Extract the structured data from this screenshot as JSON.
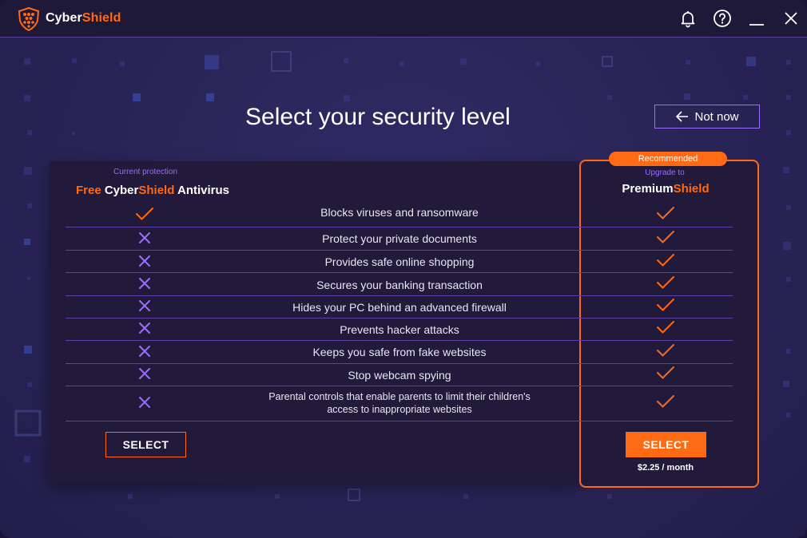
{
  "app": {
    "title_part1": "Cyber",
    "title_part2": "Shield",
    "logo_icon": "shield-icon"
  },
  "titlebar_icons": [
    "bell-icon",
    "help-icon",
    "minimize-icon",
    "close-icon"
  ],
  "headline": "Select your security level",
  "not_now": {
    "label": "Not now",
    "icon": "arrow-left-icon"
  },
  "free_plan": {
    "subtitle": "Current protection",
    "title_part1": "Free ",
    "title_part2": "Cyber",
    "title_part3": "Shield",
    "title_part4": " Antivirus",
    "select_label": "SELECT"
  },
  "premium_plan": {
    "badge": "Recommended",
    "subtitle": "Upgrade to",
    "title_part1": "Premium",
    "title_part2": "Shield",
    "select_label": "SELECT",
    "price": "$2.25 / month"
  },
  "features": [
    {
      "label": "Blocks viruses and ransomware",
      "free": "check",
      "premium": "check"
    },
    {
      "label": "Protect your private documents",
      "free": "cross",
      "premium": "check"
    },
    {
      "label": "Provides safe online shopping",
      "free": "cross",
      "premium": "check"
    },
    {
      "label": "Secures your banking transaction",
      "free": "cross",
      "premium": "check"
    },
    {
      "label": "Hides your PC behind an advanced firewall",
      "free": "cross",
      "premium": "check"
    },
    {
      "label": "Prevents hacker attacks",
      "free": "cross",
      "premium": "check"
    },
    {
      "label": "Keeps you safe from fake websites",
      "free": "cross",
      "premium": "check"
    },
    {
      "label": "Stop webcam spying",
      "free": "cross",
      "premium": "check"
    },
    {
      "label_line1": "Parental controls that enable parents to limit their children's",
      "label_line2": "access to inappropriate websites",
      "free": "cross",
      "premium": "check"
    }
  ],
  "colors": {
    "accent": "#ff6a13",
    "purple": "#9b6dff",
    "background": "#2a2558",
    "card": "#211a3b"
  }
}
